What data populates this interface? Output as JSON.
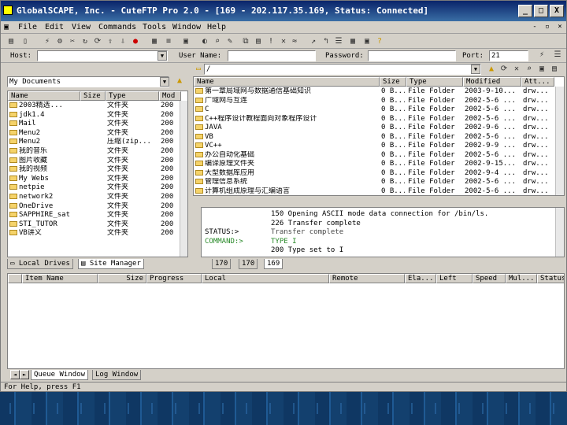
{
  "window": {
    "title": "GlobalSCAPE, Inc. - CuteFTP Pro 2.0 - [169 - 202.117.35.169, Status: Connected]",
    "min": "_",
    "max": "□",
    "close": "X",
    "mdi_min": "-",
    "mdi_restore": "▫",
    "mdi_close": "×"
  },
  "menu": [
    "File",
    "Edit",
    "View",
    "Commands",
    "Tools",
    "Window",
    "Help"
  ],
  "connbar": {
    "host_label": "Host:",
    "host_value": "",
    "user_label": "User Name:",
    "user_value": "",
    "pass_label": "Password:",
    "pass_value": "",
    "port_label": "Port:",
    "port_value": "21"
  },
  "local": {
    "path": "My Documents",
    "columns": [
      "Name",
      "Size",
      "Type",
      "Mod"
    ],
    "rows": [
      {
        "name": "2003精选...",
        "size": "",
        "type": "文件夹",
        "mod": "200"
      },
      {
        "name": "jdk1.4",
        "size": "",
        "type": "文件夹",
        "mod": "200"
      },
      {
        "name": "Mail",
        "size": "",
        "type": "文件夹",
        "mod": "200"
      },
      {
        "name": "Menu2",
        "size": "",
        "type": "文件夹",
        "mod": "200"
      },
      {
        "name": "Menu2",
        "size": "",
        "type": "压缩(zip...",
        "mod": "200"
      },
      {
        "name": "我的音乐",
        "size": "",
        "type": "文件夹",
        "mod": "200"
      },
      {
        "name": "图片收藏",
        "size": "",
        "type": "文件夹",
        "mod": "200"
      },
      {
        "name": "我的视频",
        "size": "",
        "type": "文件夹",
        "mod": "200"
      },
      {
        "name": "My Webs",
        "size": "",
        "type": "文件夹",
        "mod": "200"
      },
      {
        "name": "netpie",
        "size": "",
        "type": "文件夹",
        "mod": "200"
      },
      {
        "name": "network2",
        "size": "",
        "type": "文件夹",
        "mod": "200"
      },
      {
        "name": "OneDrive",
        "size": "",
        "type": "文件夹",
        "mod": "200"
      },
      {
        "name": "SAPPHIRE_sat",
        "size": "",
        "type": "文件夹",
        "mod": "200"
      },
      {
        "name": "STI_TUTOR",
        "size": "",
        "type": "文件夹",
        "mod": "200"
      },
      {
        "name": "VB讲义",
        "size": "",
        "type": "文件夹",
        "mod": "200"
      }
    ],
    "tabs": [
      "Local Drives",
      "Site Manager"
    ]
  },
  "remote": {
    "path": "/",
    "columns": [
      "Name",
      "Size",
      "Type",
      "Modified",
      "Att..."
    ],
    "rows": [
      {
        "name": "第一章局域网与数据通信基础知识",
        "size": "0 B...",
        "type": "File Folder",
        "mod": "2003-9-10...",
        "attr": "drw..."
      },
      {
        "name": "广域网与互连",
        "size": "0 B...",
        "type": "File Folder",
        "mod": "2002-5-6 ...",
        "attr": "drw..."
      },
      {
        "name": "C",
        "size": "0 B...",
        "type": "File Folder",
        "mod": "2002-5-6 ...",
        "attr": "drw..."
      },
      {
        "name": "C++程序设计教程面向对象程序设计",
        "size": "0 B...",
        "type": "File Folder",
        "mod": "2002-5-6 ...",
        "attr": "drw..."
      },
      {
        "name": "JAVA",
        "size": "0 B...",
        "type": "File Folder",
        "mod": "2002-9-6 ...",
        "attr": "drw..."
      },
      {
        "name": "VB",
        "size": "0 B...",
        "type": "File Folder",
        "mod": "2002-5-6 ...",
        "attr": "drw..."
      },
      {
        "name": "VC++",
        "size": "0 B...",
        "type": "File Folder",
        "mod": "2002-9-9 ...",
        "attr": "drw..."
      },
      {
        "name": "办公自动化基础",
        "size": "0 B...",
        "type": "File Folder",
        "mod": "2002-5-6 ...",
        "attr": "drw..."
      },
      {
        "name": "编译原理文件夹",
        "size": "0 B...",
        "type": "File Folder",
        "mod": "2002-9-15...",
        "attr": "drw..."
      },
      {
        "name": "大型数据库应用",
        "size": "0 B...",
        "type": "File Folder",
        "mod": "2002-9-4 ...",
        "attr": "drw..."
      },
      {
        "name": "管理信息系统",
        "size": "0 B...",
        "type": "File Folder",
        "mod": "2002-5-6 ...",
        "attr": "drw..."
      },
      {
        "name": "计算机组成原理与汇编语言",
        "size": "0 B...",
        "type": "File Folder",
        "mod": "2002-5-6 ...",
        "attr": "drw..."
      }
    ]
  },
  "log": {
    "lines": [
      {
        "label": "",
        "text": "150 Opening ASCII mode data connection for /bin/ls."
      },
      {
        "label": "",
        "text": "226 Transfer complete"
      },
      {
        "label": "STATUS:>",
        "text": "Transfer complete"
      },
      {
        "label": "COMMAND:>",
        "text": "TYPE I"
      },
      {
        "label": "",
        "text": "200 Type set to I"
      }
    ],
    "tabs": [
      "170",
      "170",
      "169"
    ]
  },
  "queue": {
    "columns": [
      "Item Name",
      "Size",
      "Progress",
      "Local",
      "Remote",
      "Ela...",
      "Left",
      "Speed",
      "Mul...",
      "Status"
    ],
    "tabs": [
      "Queue Window",
      "Log Window"
    ]
  },
  "statusbar": {
    "text": "For Help, press F1"
  },
  "colors": {
    "titlebar_start": "#0a246a",
    "titlebar_end": "#3a6ea5",
    "face": "#d4d0c8",
    "desktop": "#13406e"
  }
}
